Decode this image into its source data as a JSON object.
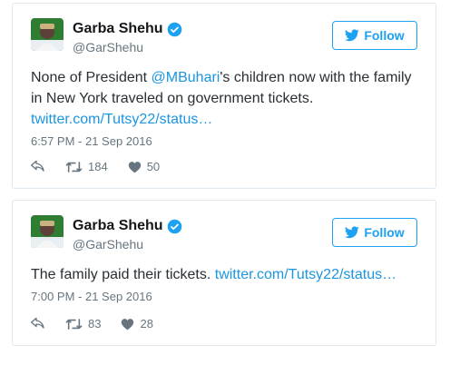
{
  "tweets": [
    {
      "display_name": "Garba Shehu",
      "handle": "@GarShehu",
      "follow_label": "Follow",
      "text_before": "None of President ",
      "mention": "@MBuhari",
      "text_after": "'s children now with the family in New York traveled on government tickets.",
      "link": "twitter.com/Tutsy22/status…",
      "timestamp": "6:57 PM - 21 Sep 2016",
      "retweets": "184",
      "likes": "50"
    },
    {
      "display_name": "Garba Shehu",
      "handle": "@GarShehu",
      "follow_label": "Follow",
      "text_before": "The family paid their tickets. ",
      "link": "twitter.com/Tutsy22/status…",
      "timestamp": "7:00 PM - 21 Sep 2016",
      "retweets": "83",
      "likes": "28"
    }
  ],
  "icons": {
    "reply": "reply-icon",
    "retweet": "retweet-icon",
    "like": "heart-icon",
    "verified": "verified-badge-icon",
    "follow": "twitter-bird-icon"
  },
  "colors": {
    "accent": "#1da1f2",
    "link": "#1b95e0",
    "muted": "#66757f"
  }
}
